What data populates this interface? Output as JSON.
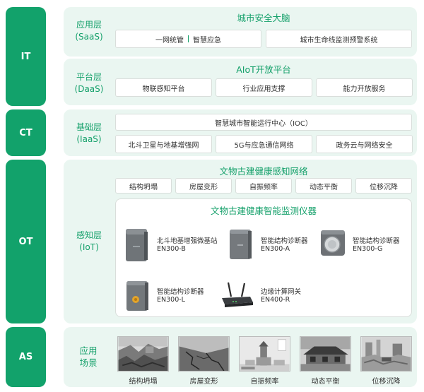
{
  "tiers": {
    "it": "IT",
    "ct": "CT",
    "ot": "OT",
    "as": "AS"
  },
  "saas": {
    "label_cn": "应用层",
    "label_en": "(SaaS)",
    "title": "城市安全大脑",
    "box1_a": "一网统管",
    "box1_b": "智慧应急",
    "box2": "城市生命线监测预警系统"
  },
  "daas": {
    "label_cn": "平台层",
    "label_en": "(DaaS)",
    "title": "AIoT开放平台",
    "boxes": [
      "物联感知平台",
      "行业应用支撑",
      "能力开放服务"
    ]
  },
  "iaas": {
    "label_cn": "基础层",
    "label_en": "(IaaS)",
    "ioc": "智慧城市智能运行中心（IOC）",
    "boxes": [
      "北斗卫星与地基增强网",
      "5G与应急通信网络",
      "政务云与网络安全"
    ]
  },
  "iot": {
    "label_cn": "感知层",
    "label_en": "(IoT)",
    "network_title": "文物古建健康感知网络",
    "categories": [
      "结构坍塌",
      "房屋变形",
      "自振频率",
      "动态平衡",
      "位移沉降"
    ],
    "instrument_title": "文物古建健康智能监测仪器",
    "devices": [
      {
        "name": "北斗地基增强微基站",
        "model": "EN300-B"
      },
      {
        "name": "智能结构诊断器",
        "model": "EN300-A"
      },
      {
        "name": "智能结构诊断器",
        "model": "EN300-G"
      },
      {
        "name": "智能结构诊断器",
        "model": "EN300-L"
      },
      {
        "name": "边缘计算网关",
        "model": "EN400-R"
      }
    ]
  },
  "scenes": {
    "label_line1": "应用",
    "label_line2": "场景",
    "items": [
      "结构坍塌",
      "房屋变形",
      "自振频率",
      "动态平衡",
      "位移沉降"
    ]
  }
}
